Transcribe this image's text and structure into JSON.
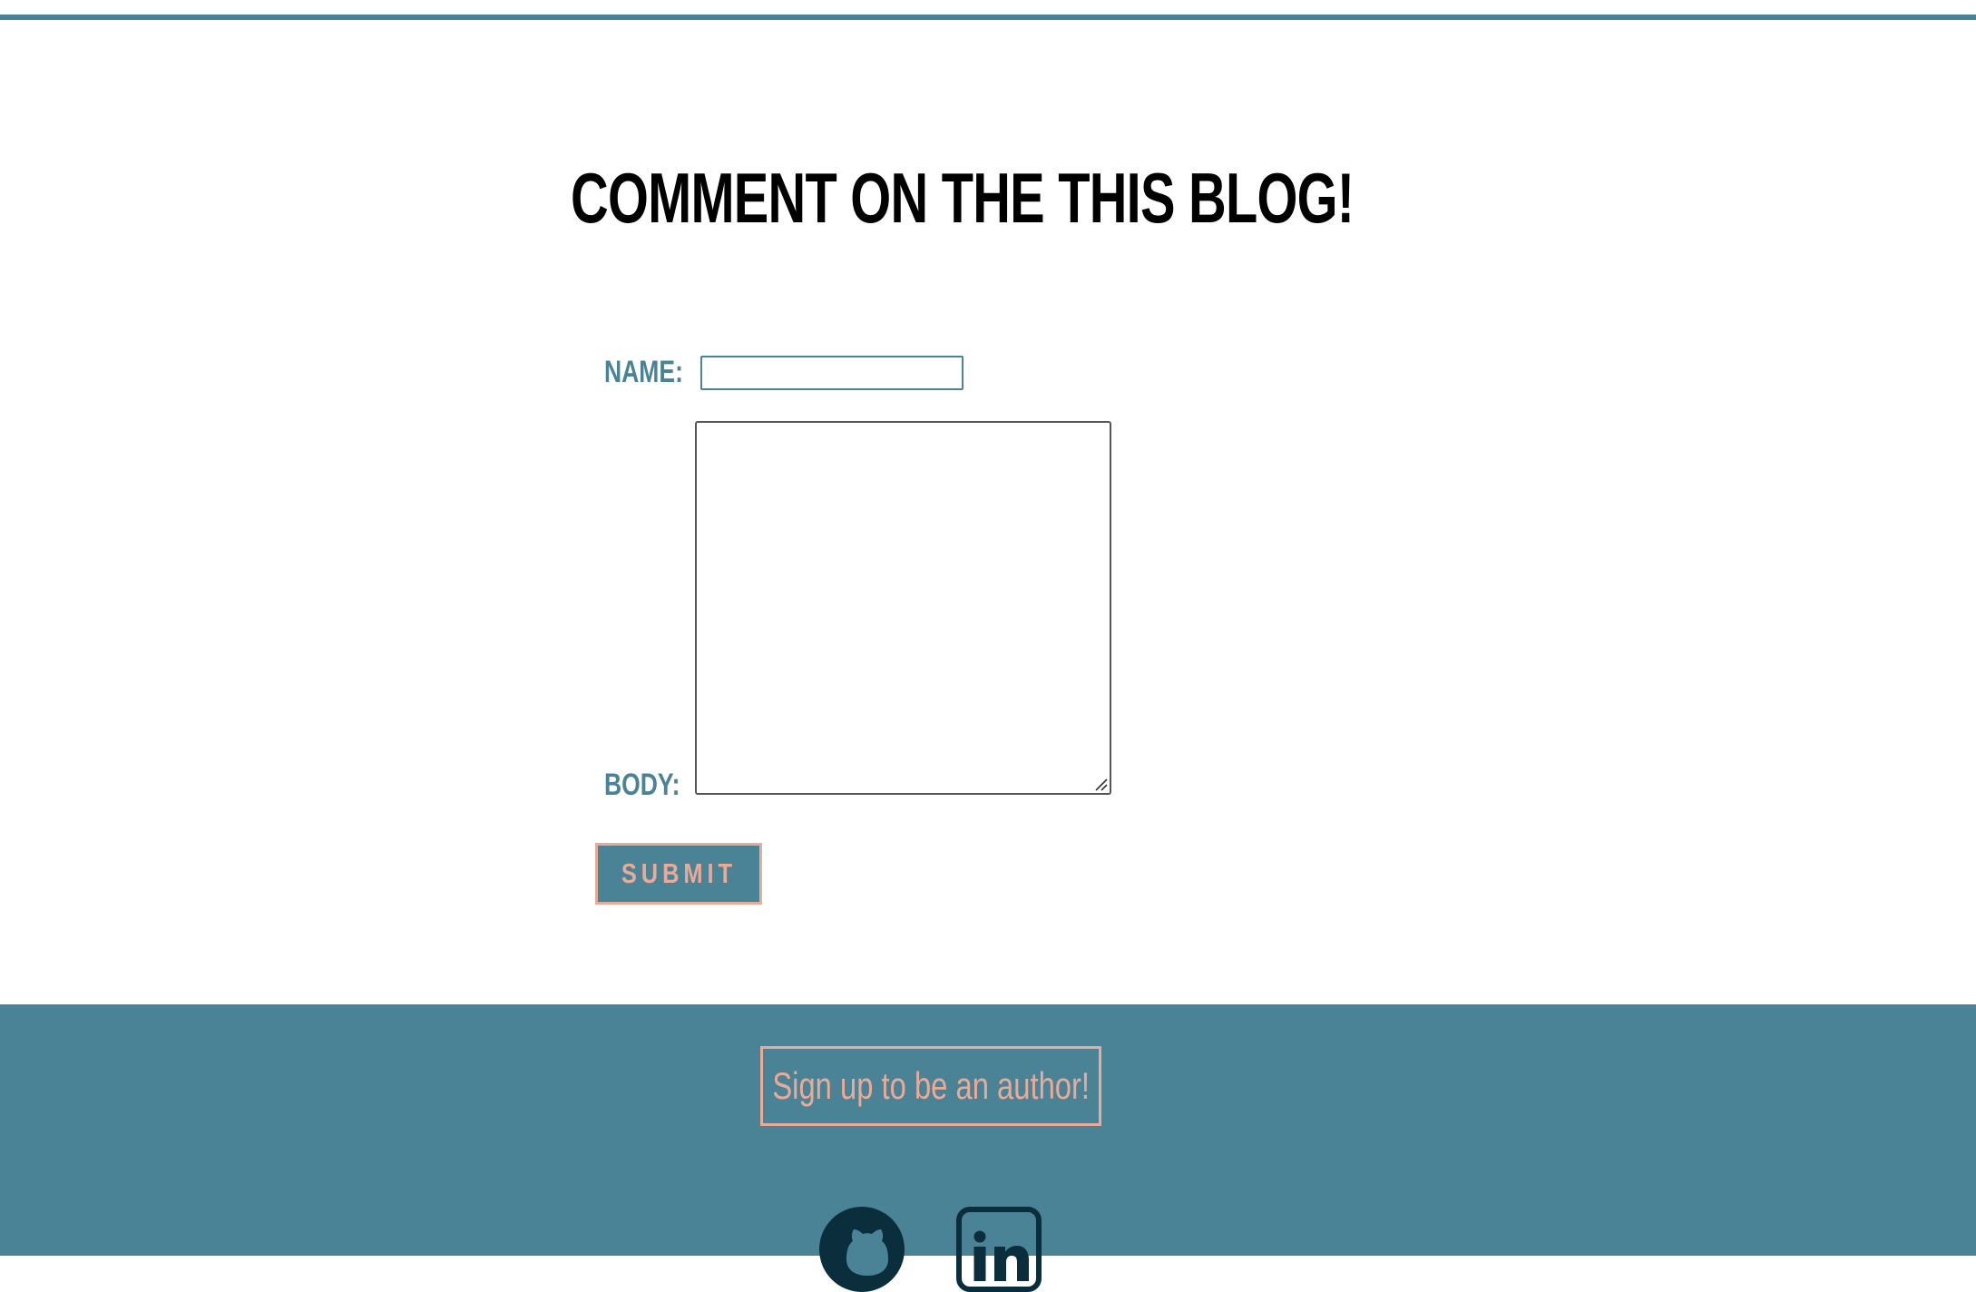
{
  "colors": {
    "accent": "#4a8396",
    "highlight": "#e9aa97",
    "icon": "#0b2e3d",
    "title": "#000000"
  },
  "page": {
    "title": "Comment on the this blog!"
  },
  "form": {
    "name_label": "Name:",
    "name_value": "",
    "body_label": "Body:",
    "body_value": "",
    "submit_label": "Submit"
  },
  "footer": {
    "signup_label": "Sign up to be an author!",
    "icons": [
      "github-icon",
      "linkedin-icon"
    ]
  }
}
